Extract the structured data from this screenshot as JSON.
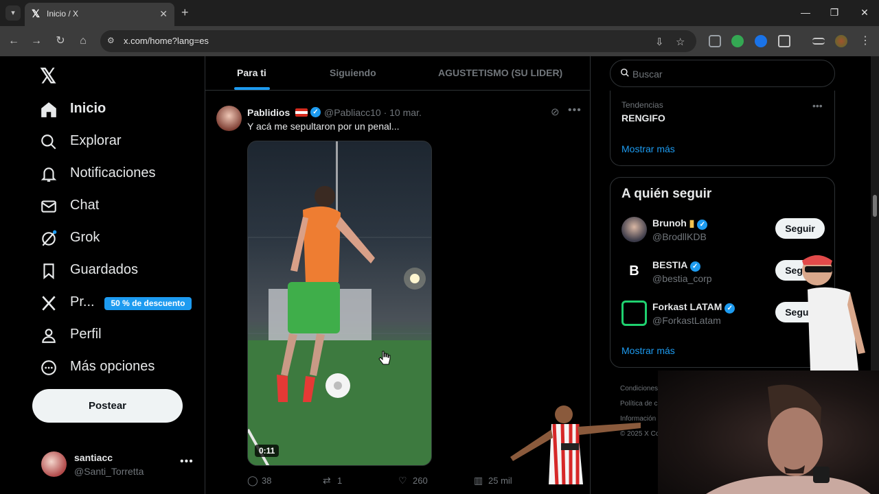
{
  "browser": {
    "tab_title": "Inicio / X",
    "url": "x.com/home?lang=es"
  },
  "sidebar": {
    "items": [
      {
        "label": "Inicio",
        "icon": "home-icon"
      },
      {
        "label": "Explorar",
        "icon": "search-icon"
      },
      {
        "label": "Notificaciones",
        "icon": "bell-icon"
      },
      {
        "label": "Chat",
        "icon": "mail-icon"
      },
      {
        "label": "Grok",
        "icon": "grok-icon"
      },
      {
        "label": "Guardados",
        "icon": "bookmark-icon"
      },
      {
        "label": "Pr...",
        "icon": "x-premium-icon"
      },
      {
        "label": "Perfil",
        "icon": "person-icon"
      },
      {
        "label": "Más opciones",
        "icon": "more-circle-icon"
      }
    ],
    "premium_badge": "50 % de descuento",
    "post_button": "Postear",
    "account": {
      "name": "santiacc",
      "handle": "@Santi_Torretta"
    }
  },
  "main": {
    "tabs": [
      "Para ti",
      "Siguiendo",
      "AGUSTETISMO (SU LIDER)"
    ],
    "post": {
      "author": "Pablidios",
      "handle_time": "@Pabliacc10 · 10 mar.",
      "text": "Y acá me sepultaron por un penal...",
      "video_duration": "0:11",
      "replies": "38",
      "reposts": "1",
      "likes": "260",
      "views": "25 mil"
    }
  },
  "right": {
    "search_placeholder": "Buscar",
    "trend": {
      "category": "Tendencias",
      "name": "RENGIFO"
    },
    "show_more": "Mostrar más",
    "who_to_follow": {
      "title": "A quién seguir",
      "accounts": [
        {
          "name": "Brunoh",
          "handle": "@BrodllKDB"
        },
        {
          "name": "BESTIA",
          "handle": "@bestia_corp"
        },
        {
          "name": "Forkast LATAM",
          "handle": "@ForkastLatam"
        }
      ],
      "follow_label": "Seguir",
      "show_more": "Mostrar más"
    },
    "footer": [
      "Condiciones",
      "Política de c",
      "Información",
      "© 2025 X Co"
    ]
  },
  "colors": {
    "accent": "#1d9bf0",
    "background": "#000000",
    "border": "#2f3336",
    "muted": "#71767b"
  }
}
